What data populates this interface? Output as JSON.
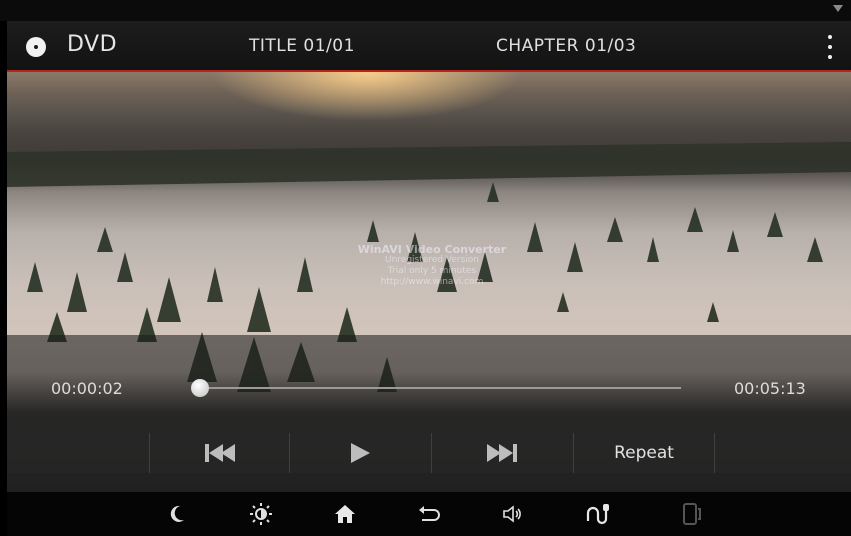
{
  "header": {
    "source": "DVD",
    "title_info": "TITLE 01/01",
    "chapter_info": "CHAPTER 01/03"
  },
  "video": {
    "watermark_lines": [
      "WinAVI Video Converter",
      "Unregistered Version",
      "Trial only 5 minutes",
      "http://www.winavi.com"
    ]
  },
  "playback": {
    "elapsed": "00:00:02",
    "total": "00:05:13",
    "progress_fraction": 0.006
  },
  "transport": {
    "repeat_label": "Repeat"
  },
  "icons": {
    "status": "wifi-icon",
    "header": [
      "disc-icon",
      "more-vertical-icon"
    ],
    "transport": [
      "skip-previous-icon",
      "play-icon",
      "skip-next-icon"
    ],
    "nav": [
      "night-mode-icon",
      "brightness-icon",
      "home-icon",
      "back-icon",
      "volume-icon",
      "voice-icon",
      "phone-icon"
    ]
  },
  "colors": {
    "accent_line": "#b3261e",
    "bar_background": "#141414"
  }
}
